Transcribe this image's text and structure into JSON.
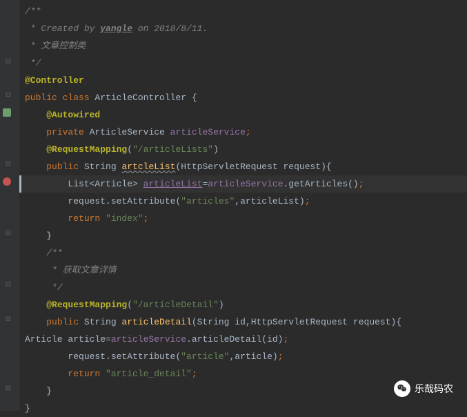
{
  "code": {
    "l1": "/**",
    "l2_a": " * Created by ",
    "l2_b": "yangle",
    "l2_c": " on 2018/8/11.",
    "l3": " * 文章控制类",
    "l4": " */",
    "l5": "@Controller",
    "l6_a": "public",
    "l6_b": " class",
    "l6_c": " ArticleController {",
    "l7": "@Autowired",
    "l8_a": "private",
    "l8_b": " ArticleService ",
    "l8_c": "articleService",
    "l8_d": ";",
    "l9_a": "@RequestMapping",
    "l9_b": "(",
    "l9_c": "\"/articleLists\"",
    "l9_d": ")",
    "l10_a": "public",
    "l10_b": " String ",
    "l10_c": "artcleList",
    "l10_d": "(HttpServletRequest request){",
    "l11_a": "List<Article> ",
    "l11_b": "articleList",
    "l11_c": "=",
    "l11_d": "articleService",
    "l11_e": ".getArticles()",
    "l11_f": ";",
    "l12_a": "request.setAttribute(",
    "l12_b": "\"articles\"",
    "l12_c": ",articleList)",
    "l12_d": ";",
    "l13_a": "return ",
    "l13_b": "\"index\"",
    "l13_c": ";",
    "l14": "}",
    "l15": "/**",
    "l16": " * 获取文章详情",
    "l17": " */",
    "l18_a": "@RequestMapping",
    "l18_b": "(",
    "l18_c": "\"/articleDetail\"",
    "l18_d": ")",
    "l19_a": "public",
    "l19_b": " String ",
    "l19_c": "articleDetail",
    "l19_d": "(String id,HttpServletRequest request){",
    "l20_a": "Article article=",
    "l20_b": "articleService",
    "l20_c": ".articleDetail(id)",
    "l20_d": ";",
    "l21_a": "request.setAttribute(",
    "l21_b": "\"article\"",
    "l21_c": ",article)",
    "l21_d": ";",
    "l22_a": "return ",
    "l22_b": "\"article_detail\"",
    "l22_c": ";",
    "l23": "}",
    "l24": "}"
  },
  "watermark": {
    "text": "乐哉码农"
  },
  "gutter": {
    "fold_minus": "⊟",
    "fold_plus": "⊞"
  }
}
